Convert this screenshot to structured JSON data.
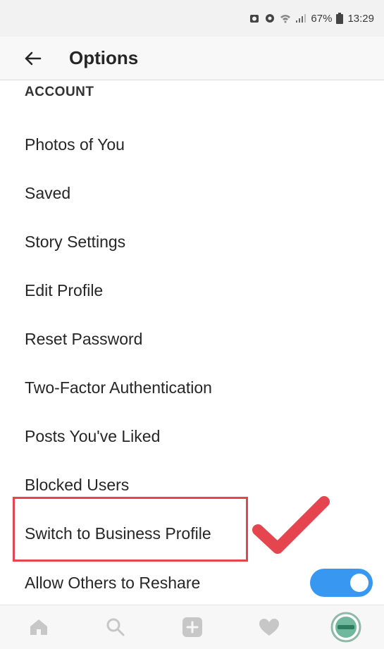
{
  "status_bar": {
    "battery": "67%",
    "time": "13:29"
  },
  "header": {
    "title": "Options"
  },
  "section": {
    "title": "ACCOUNT"
  },
  "options": [
    "Photos of You",
    "Saved",
    "Story Settings",
    "Edit Profile",
    "Reset Password",
    "Two-Factor Authentication",
    "Posts You've Liked",
    "Blocked Users",
    "Switch to Business Profile",
    "Allow Others to Reshare"
  ],
  "toggle": {
    "on": true
  },
  "colors": {
    "accent": "#3897f0",
    "highlight": "#e5454f"
  },
  "tabs": [
    "home-icon",
    "search-icon",
    "add-icon",
    "heart-icon",
    "avatar"
  ]
}
